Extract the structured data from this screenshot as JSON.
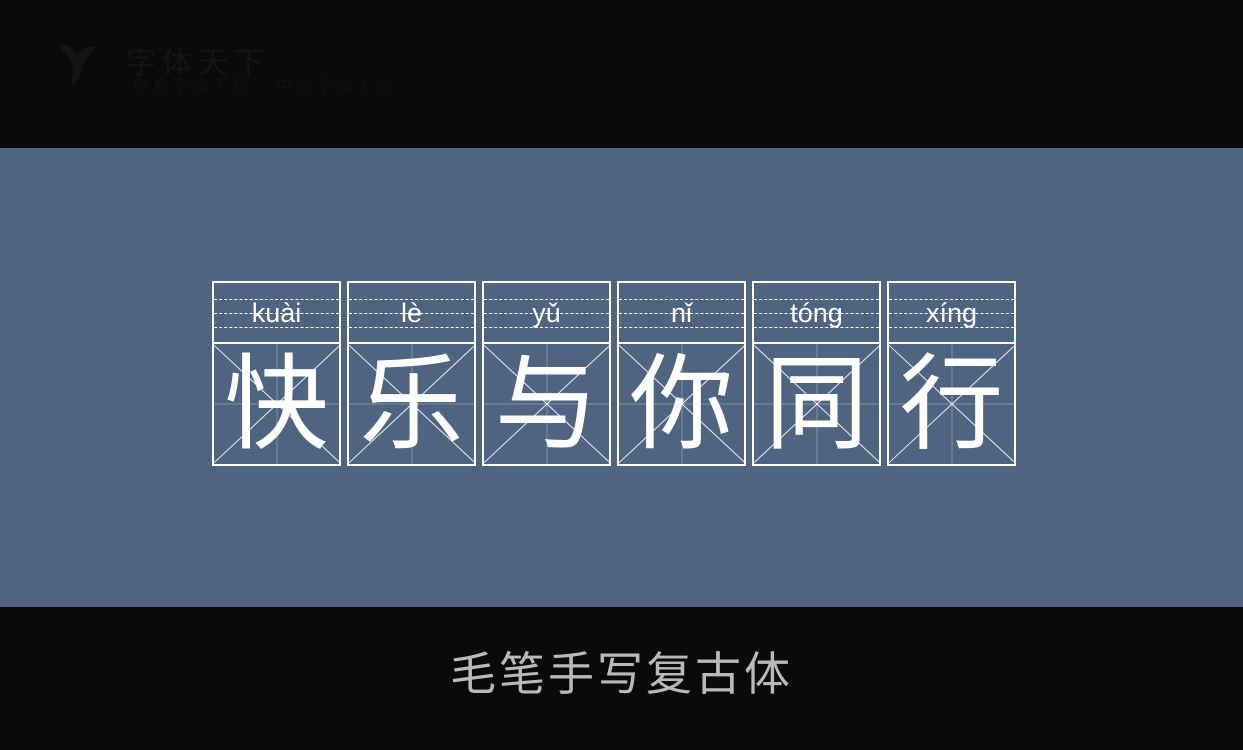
{
  "banner": {
    "logo_icon": "dove-logo-icon",
    "title": "字体天下",
    "subtitle": "免费字体下载 · 中文字体大全",
    "background_color": "#0a0a0a",
    "text_color": "#141414"
  },
  "stage": {
    "background_color": "#4e6480",
    "grid_line_color": "#ffffff",
    "phrase": "快乐与你同行",
    "cells": [
      {
        "pinyin": "kuài",
        "character": "快"
      },
      {
        "pinyin": "lè",
        "character": "乐"
      },
      {
        "pinyin": "yǔ",
        "character": "与"
      },
      {
        "pinyin": "nǐ",
        "character": "你"
      },
      {
        "pinyin": "tóng",
        "character": "同"
      },
      {
        "pinyin": "xíng",
        "character": "行"
      }
    ]
  },
  "footer": {
    "caption": "毛笔手写复古体",
    "background_color": "#0a0a0a",
    "text_color": "#b9b9b9"
  }
}
